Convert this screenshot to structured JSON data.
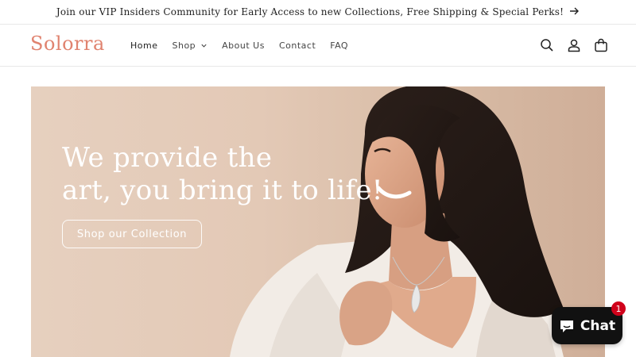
{
  "announcement": {
    "text": "Join our VIP Insiders Community for Early Access to new Collections, Free Shipping & Special Perks!",
    "arrow_icon": "arrow-right-icon"
  },
  "header": {
    "logo": "Solorra",
    "nav": [
      {
        "label": "Home"
      },
      {
        "label": "Shop"
      },
      {
        "label": "About Us"
      },
      {
        "label": "Contact"
      },
      {
        "label": "FAQ"
      }
    ],
    "icons": [
      "search-icon",
      "account-icon",
      "cart-icon"
    ]
  },
  "hero": {
    "title_line1": "We provide the",
    "title_line2": "art, you bring it to life!",
    "button_label": "Shop our Collection"
  },
  "chat": {
    "label": "Chat",
    "badge": "1"
  },
  "colors": {
    "logo": "#e0836f",
    "hero_bg": "#e3c9b6",
    "chat_bg": "#111111",
    "badge": "#d0021b"
  }
}
